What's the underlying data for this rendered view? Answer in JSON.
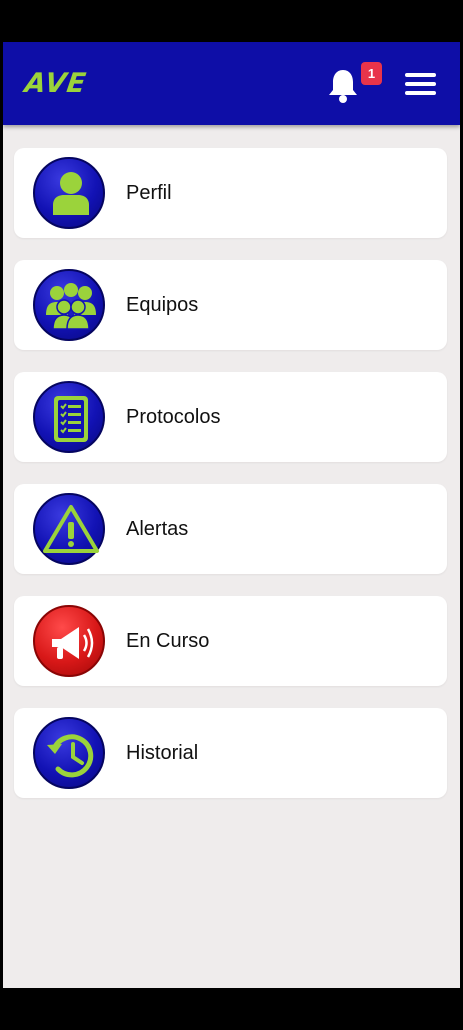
{
  "header": {
    "logo": "AVE",
    "notification_count": "1",
    "icons": {
      "notification": "bell-icon",
      "menu": "hamburger-menu-icon"
    }
  },
  "menu": [
    {
      "label": "Perfil",
      "icon": "profile-icon"
    },
    {
      "label": "Equipos",
      "icon": "team-icon"
    },
    {
      "label": "Protocolos",
      "icon": "checklist-icon"
    },
    {
      "label": "Alertas",
      "icon": "warning-icon"
    },
    {
      "label": "En Curso",
      "icon": "megaphone-icon"
    },
    {
      "label": "Historial",
      "icon": "history-icon"
    }
  ],
  "colors": {
    "header_bg": "#0e0ea7",
    "accent_green": "#9bd33b",
    "icon_blue": "#1212b4",
    "icon_red": "#d81818",
    "badge": "#e8344a",
    "background": "#efecec"
  }
}
